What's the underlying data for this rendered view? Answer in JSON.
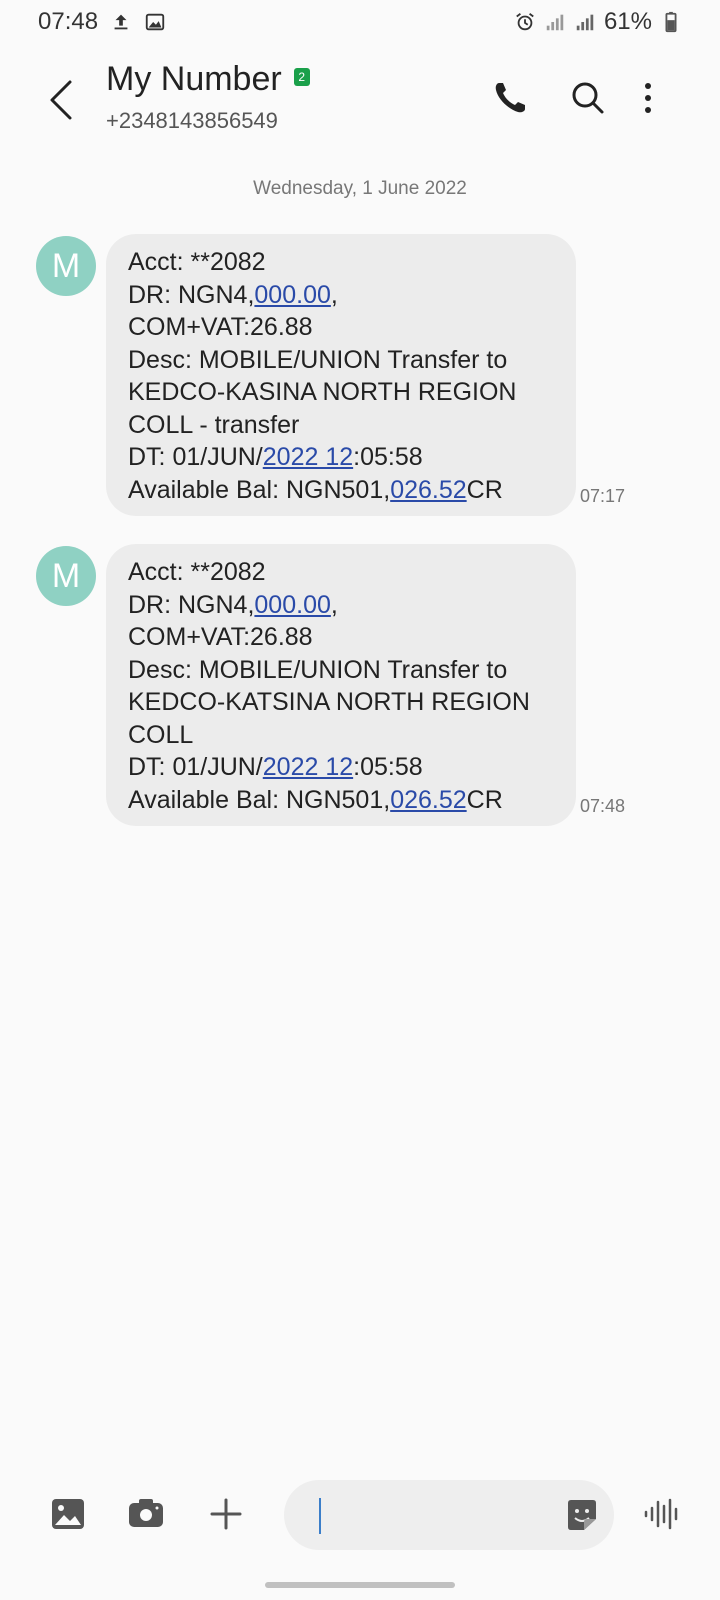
{
  "status_bar": {
    "time": "07:48",
    "battery": "61%",
    "icons": [
      "upload-icon",
      "image-icon",
      "alarm-icon",
      "signal-icon",
      "signal-icon",
      "battery-icon"
    ]
  },
  "header": {
    "contact_name": "My Number",
    "sim_badge": "2",
    "contact_number": "+2348143856549",
    "icons": [
      "back-icon",
      "phone-icon",
      "search-icon",
      "more-vertical-icon"
    ]
  },
  "conversation": {
    "date_separator": "Wednesday, 1 June 2022",
    "messages": [
      {
        "avatar_initial": "M",
        "lines": {
          "l1": "Acct: **2082",
          "l2_prefix": "DR: NGN4,",
          "l2_link": "000.00",
          "l2_suffix": ",",
          "l3": "COM+VAT:26.88",
          "l4": "Desc: MOBILE/UNION Transfer to",
          "l5": "KEDCO-KASINA NORTH REGION",
          "l6": "COLL - transfer",
          "l7_prefix": "DT: 01/JUN/",
          "l7_link": "2022 12",
          "l7_suffix": ":05:58",
          "l8_prefix": "Available Bal: NGN501,",
          "l8_link": "026.52",
          "l8_suffix": "CR"
        },
        "time": "07:17"
      },
      {
        "avatar_initial": "M",
        "lines": {
          "l1": "Acct: **2082",
          "l2_prefix": "DR: NGN4,",
          "l2_link": "000.00",
          "l2_suffix": ",",
          "l3": "COM+VAT:26.88",
          "l4": "Desc: MOBILE/UNION Transfer to",
          "l5": "KEDCO-KATSINA NORTH REGION",
          "l6": "COLL",
          "l7_prefix": "DT: 01/JUN/",
          "l7_link": "2022 12",
          "l7_suffix": ":05:58",
          "l8_prefix": "Available Bal: NGN501,",
          "l8_link": "026.52",
          "l8_suffix": "CR"
        },
        "time": "07:48"
      }
    ]
  },
  "compose": {
    "input_value": "",
    "icons": [
      "gallery-icon",
      "camera-icon",
      "plus-icon",
      "sticker-icon",
      "voice-icon"
    ]
  },
  "colors": {
    "avatar": "#8fd1c3",
    "bubble": "#ececec",
    "link": "#2a4aa8",
    "sim_badge": "#1aa04a",
    "cursor": "#3b7ec9"
  }
}
